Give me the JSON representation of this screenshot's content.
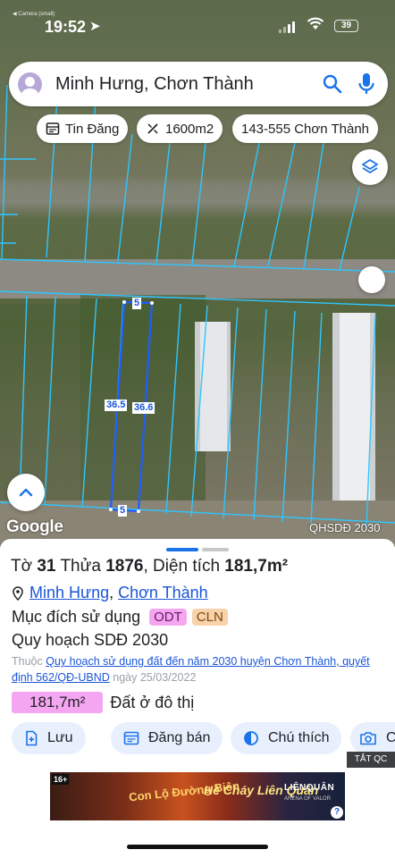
{
  "status_bar": {
    "time": "19:52",
    "mini_label": "◀ Camera (small)",
    "battery": "39"
  },
  "search": {
    "query": "Minh Hưng, Chơn Thành"
  },
  "chips": {
    "news": "Tin Đăng",
    "area": "1600m2",
    "route": "143-555 Chơn Thành"
  },
  "map": {
    "dims": {
      "top": "5",
      "left": "36.5",
      "right": "36.6",
      "bottom": "5"
    },
    "google": "Google",
    "layer_label": "QHSDĐ 2030"
  },
  "parcel": {
    "title_prefix": "Tờ",
    "sheet_no": "31",
    "plot_word": "Thửa",
    "plot_no": "1876",
    "area_word": "Diện tích",
    "area": "181,7m²",
    "ward": "Minh Hưng",
    "district": "Chơn Thành",
    "purpose_label": "Mục đích sử dụng",
    "purpose_tag_1": "ODT",
    "purpose_tag_2": "CLN",
    "plan": "Quy hoạch SDĐ 2030",
    "desc_prefix": "Thuộc",
    "desc_link": "Quy hoạch sử dụng đất đến năm 2030 huyện Chơn Thành, quyết định 562/QĐ-UBND",
    "desc_date": "ngày 25/03/2022",
    "area_badge": "181,7m²",
    "area_type": "Đất ở đô thị"
  },
  "actions": {
    "save": "Lưu",
    "post": "Đăng bán",
    "legend": "Chú thích",
    "capture": "C"
  },
  "ad": {
    "close_label": "TẮT QC",
    "age": "16+",
    "text_1": "Con Lộ Đường Biên",
    "text_2": "Hè Cháy Liên Quân",
    "brand": "LIÊNQUÂN",
    "brand_sub": "ARENA OF VALOR",
    "info": "?"
  }
}
